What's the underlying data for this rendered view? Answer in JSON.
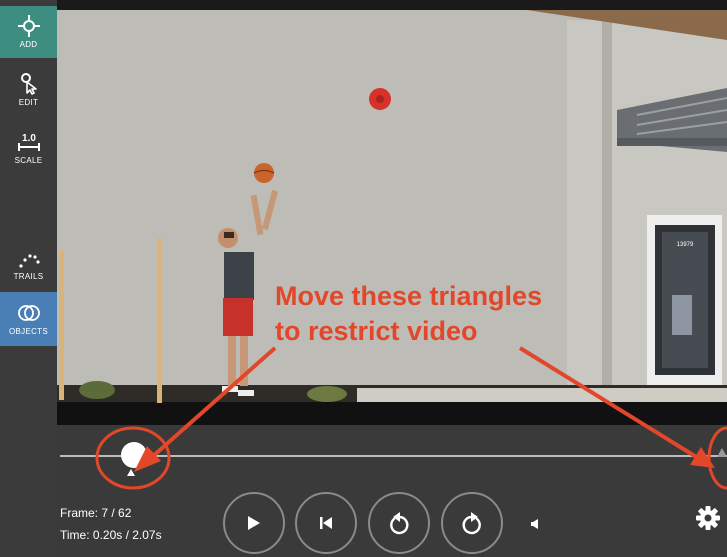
{
  "sidebar": {
    "tools": [
      {
        "label": "ADD",
        "icon": "crosshair-icon"
      },
      {
        "label": "EDIT",
        "icon": "pointer-edit-icon"
      },
      {
        "label": "SCALE",
        "icon": "scale-ruler-icon",
        "value": "1.0"
      },
      {
        "label": "TRAILS",
        "icon": "trails-icon"
      },
      {
        "label": "OBJECTS",
        "icon": "objects-icon"
      }
    ],
    "active_tool": "ADD",
    "colors": {
      "add_active": "#3d8e80",
      "objects_active": "#4a7fb5"
    }
  },
  "video": {
    "door_number": "13979"
  },
  "annotation": {
    "line1": "Move these triangles",
    "line2": "to restrict video",
    "color": "#e2472a"
  },
  "playback": {
    "frame_text": "Frame: 7 / 62",
    "time_text": "Time: 0.20s / 2.07s",
    "buttons": [
      "play-icon",
      "step-back-icon",
      "rotate-back-icon",
      "rotate-forward-icon"
    ]
  }
}
